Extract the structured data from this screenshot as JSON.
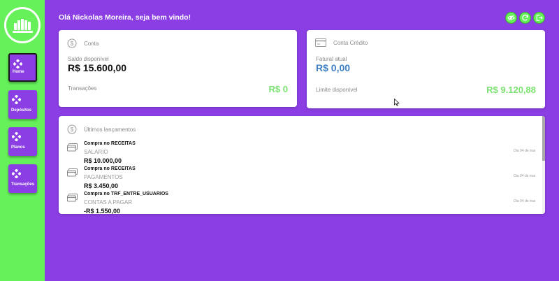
{
  "greeting": "Olá Nickolas Moreira, seja bem vindo!",
  "nav": [
    {
      "label": "Home"
    },
    {
      "label": "Depósitos"
    },
    {
      "label": "Planos"
    },
    {
      "label": "Transações"
    }
  ],
  "account": {
    "title": "Conta",
    "balance_label": "Saldo disponível",
    "balance": "R$ 15.600,00",
    "transactions_label": "Transações",
    "transactions_value": "R$ 0"
  },
  "credit": {
    "title": "Conta Crédito",
    "invoice_label": "Fatural atual",
    "invoice": "R$ 0,00",
    "limit_label": "Limite disponível",
    "limit": "R$ 9.120,88"
  },
  "recent": {
    "title": "Últimos lançamentos",
    "items": [
      {
        "desc": "Compra no RECEITAS",
        "category": "SALARIO",
        "value": "R$ 10.000,00",
        "date": "Dia 04 de mai"
      },
      {
        "desc": "Compra no RECEITAS",
        "category": "PAGAMENTOS",
        "value": "R$ 3.450,00",
        "date": "Dia 04 de mai"
      },
      {
        "desc": "Compra no TRF_ENTRE_USUARIOS",
        "category": "CONTAS A PAGAR",
        "value": "-R$ 1.550,00",
        "date": "Dia 04 de mai"
      }
    ]
  },
  "colors": {
    "primary": "#8a3ee3",
    "accent": "#66f05a",
    "positive": "#7be271",
    "invoice": "#3f7fc4"
  },
  "icons": [
    "dollar-circle-icon",
    "credit-card-icon",
    "eye-icon",
    "refresh-icon",
    "logout-icon",
    "diamond-icon",
    "card-icon"
  ]
}
